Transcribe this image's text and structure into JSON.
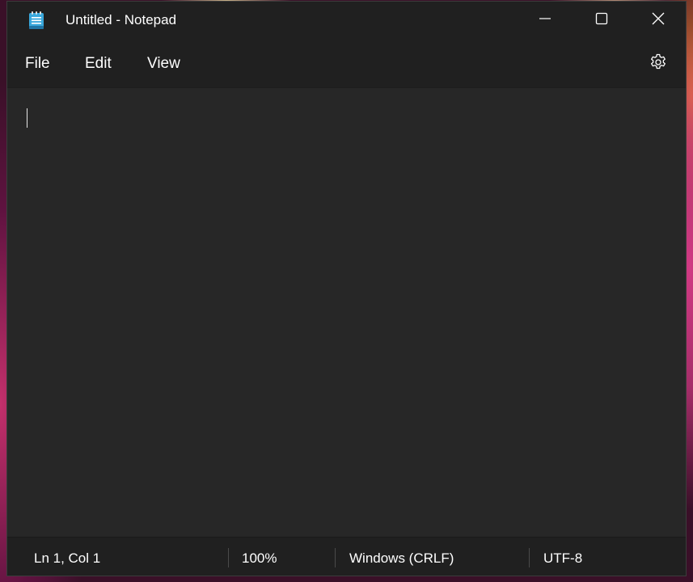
{
  "window": {
    "title": "Untitled - Notepad",
    "app_icon": "notepad-icon"
  },
  "caption_buttons": {
    "minimize_icon": "minimize-icon",
    "maximize_icon": "maximize-icon",
    "close_icon": "close-icon"
  },
  "menu": {
    "items": [
      "File",
      "Edit",
      "View"
    ],
    "settings_icon": "gear-icon"
  },
  "editor": {
    "content": ""
  },
  "status": {
    "position": "Ln 1, Col 1",
    "zoom": "100%",
    "line_ending": "Windows (CRLF)",
    "encoding": "UTF-8"
  },
  "colors": {
    "background": "#272727",
    "titlebar": "#202020",
    "text": "#ffffff",
    "accent": "#4cc2ff"
  }
}
